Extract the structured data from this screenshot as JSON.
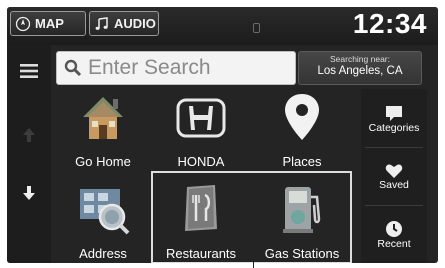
{
  "topbar": {
    "map_label": "MAP",
    "audio_label": "AUDIO",
    "clock": "12:34"
  },
  "search": {
    "placeholder": "Enter Search",
    "near_label": "Searching near:",
    "near_city": "Los Angeles, CA"
  },
  "grid": [
    {
      "label": "Go Home",
      "icon": "house-icon"
    },
    {
      "label": "HONDA",
      "icon": "honda-logo-icon"
    },
    {
      "label": "Places",
      "icon": "map-pin-icon"
    },
    {
      "label": "Address",
      "icon": "address-icon"
    },
    {
      "label": "Restaurants",
      "icon": "restaurant-icon"
    },
    {
      "label": "Gas Stations",
      "icon": "gas-pump-icon"
    }
  ],
  "right_menu": [
    {
      "label": "Categories",
      "icon": "categories-icon"
    },
    {
      "label": "Saved",
      "icon": "heart-icon"
    },
    {
      "label": "Recent",
      "icon": "clock-icon"
    }
  ],
  "colors": {
    "screen_bg": "#242424",
    "text": "#ffffff",
    "search_bg": "#f3f3f3"
  }
}
